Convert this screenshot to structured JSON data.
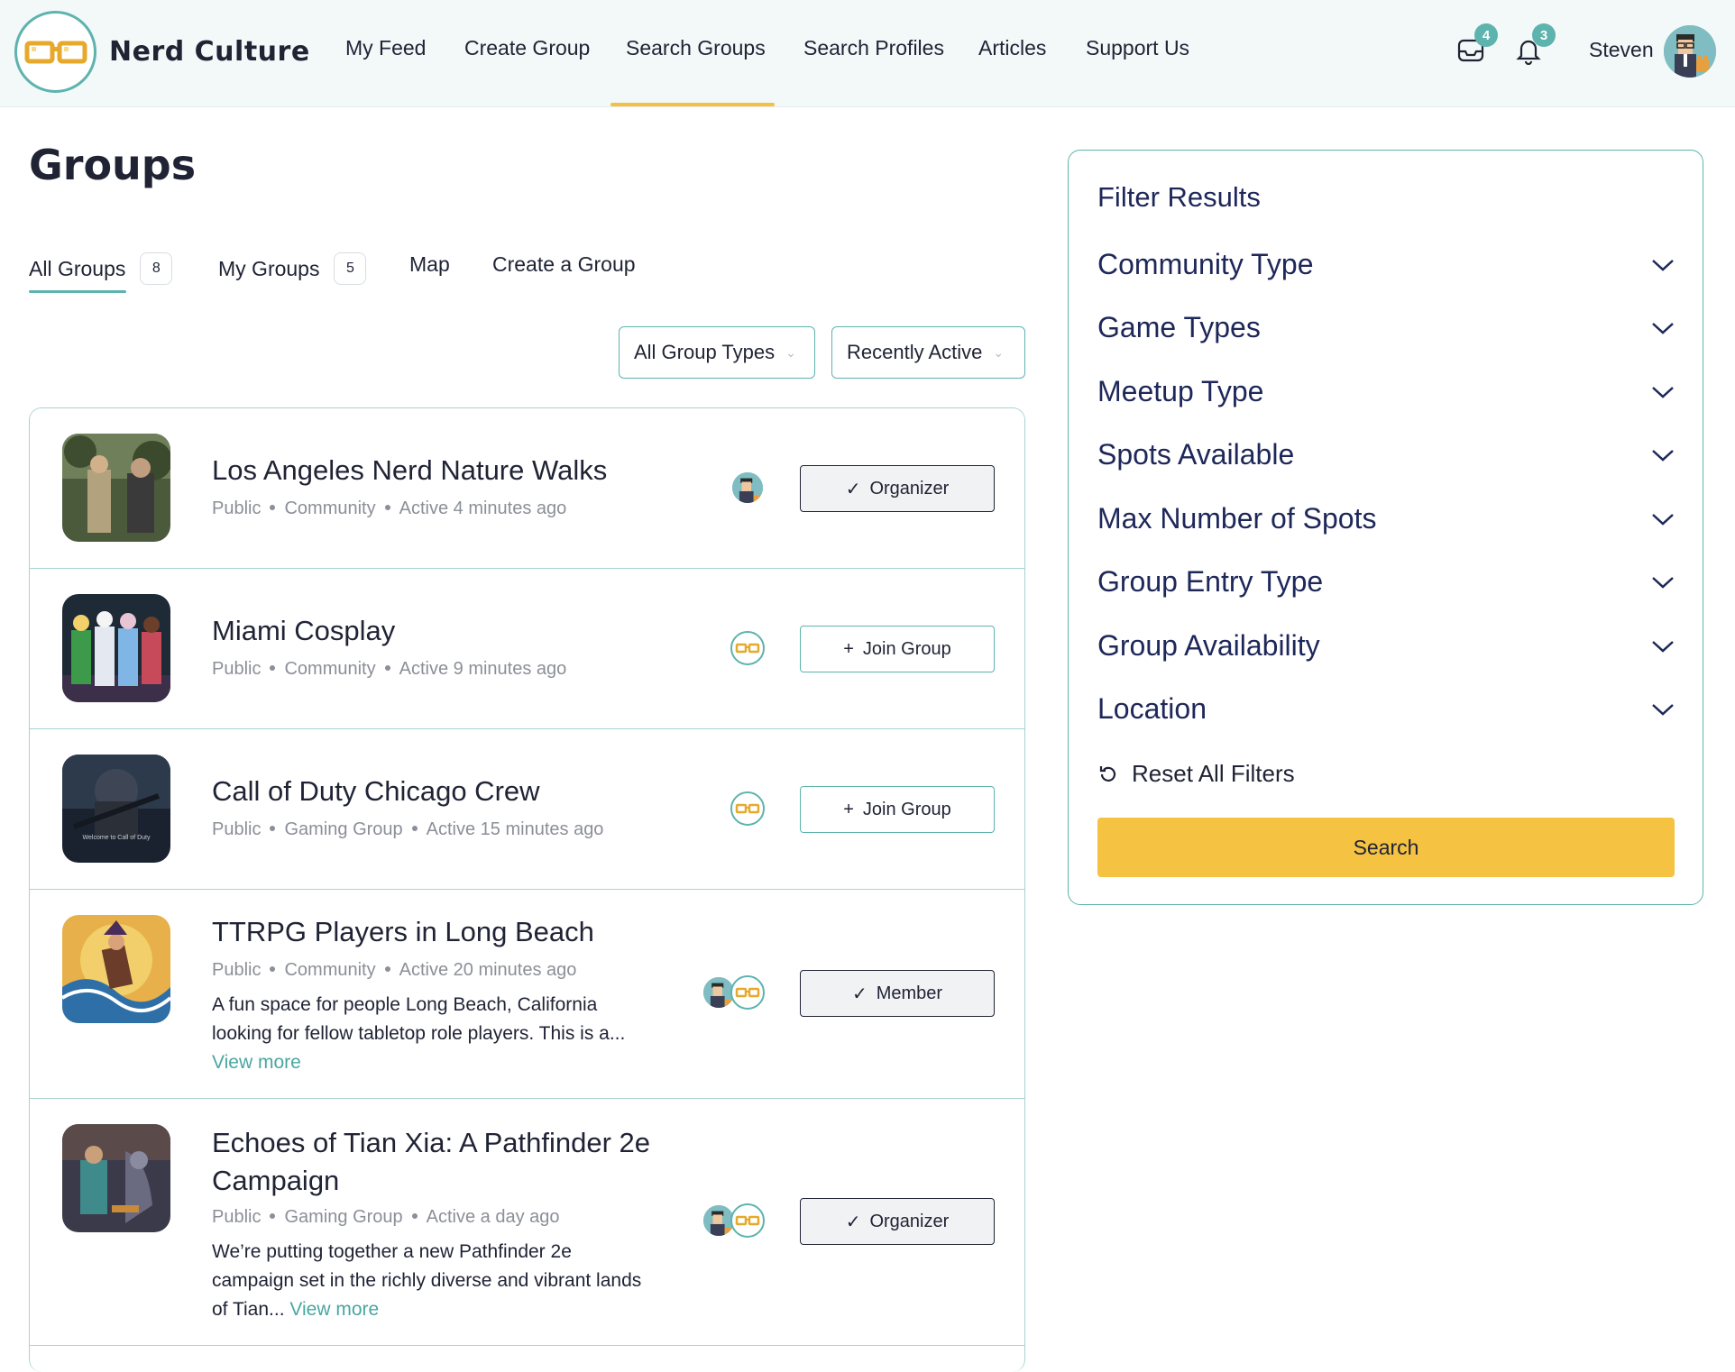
{
  "brand": {
    "name": "Nerd Culture"
  },
  "nav": {
    "items": [
      "My Feed",
      "Create Group",
      "Search Groups",
      "Search Profiles",
      "Articles",
      "Support Us"
    ],
    "active": "Search Groups"
  },
  "header": {
    "inbox_count": "4",
    "notifications_count": "3",
    "user_name": "Steven"
  },
  "page": {
    "title": "Groups"
  },
  "tabs": [
    {
      "label": "All Groups",
      "count": "8"
    },
    {
      "label": "My Groups",
      "count": "5"
    },
    {
      "label": "Map"
    },
    {
      "label": "Create a Group"
    }
  ],
  "selects": {
    "group_type": "All Group Types",
    "sort": "Recently Active"
  },
  "groups": [
    {
      "name": "Los Angeles Nerd Nature Walks",
      "visibility": "Public",
      "type": "Community",
      "activity": "Active 4 minutes ago",
      "action": "Organizer"
    },
    {
      "name": "Miami Cosplay",
      "visibility": "Public",
      "type": "Community",
      "activity": "Active 9 minutes ago",
      "action": "Join Group"
    },
    {
      "name": "Call of Duty Chicago Crew",
      "visibility": "Public",
      "type": "Gaming Group",
      "activity": "Active 15 minutes ago",
      "action": "Join Group",
      "thumb_caption": "Welcome to Call of Duty"
    },
    {
      "name": "TTRPG Players in Long Beach",
      "visibility": "Public",
      "type": "Community",
      "activity": "Active 20 minutes ago",
      "action": "Member",
      "description_line1": "A fun space for people Long Beach, California",
      "description_line2": "looking for fellow tabletop role players. This is a...",
      "view_more": "View more"
    },
    {
      "name_line1": "Echoes of Tian Xia: A Pathfinder 2e",
      "name_line2": "Campaign",
      "visibility": "Public",
      "type": "Gaming Group",
      "activity": "Active a day ago",
      "action": "Organizer",
      "description_line1": "We’re putting together a new Pathfinder 2e",
      "description_line2": "campaign set in the richly diverse and vibrant lands",
      "description_line3": "of Tian...",
      "view_more": "View more"
    }
  ],
  "filter": {
    "title": "Filter Results",
    "items": [
      "Community Type",
      "Game Types",
      "Meetup Type",
      "Spots Available",
      "Max Number of Spots",
      "Group Entry Type",
      "Group Availability",
      "Location"
    ],
    "reset_label": "Reset All Filters",
    "search_label": "Search"
  },
  "colors": {
    "teal": "#5db3ad",
    "yellow": "#f5c242",
    "navy": "#1e2759"
  },
  "icons": [
    "glasses-logo-icon",
    "inbox-icon",
    "bell-icon",
    "check-icon",
    "plus-icon",
    "chevron-down-icon",
    "reset-icon"
  ]
}
